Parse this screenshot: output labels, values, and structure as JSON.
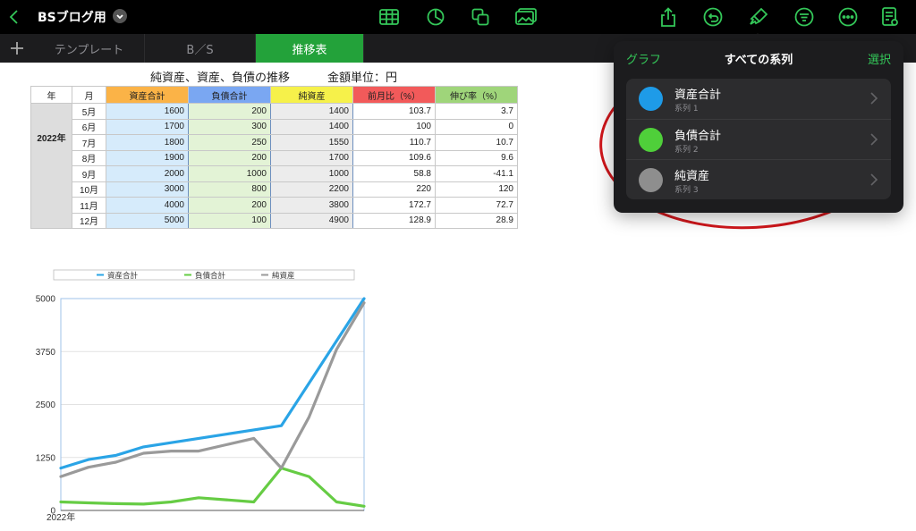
{
  "toolbar": {
    "document_title": "BSブログ用",
    "icons": [
      "back-icon",
      "table-icon",
      "chart-icon",
      "shapes-icon",
      "media-icon",
      "share-icon",
      "undo-icon",
      "format-brush-icon",
      "filter-icon",
      "more-icon",
      "document-icon"
    ]
  },
  "tabs": [
    {
      "label": "テンプレート",
      "active": false
    },
    {
      "label": "B／S",
      "active": false
    },
    {
      "label": "推移表",
      "active": true
    }
  ],
  "table": {
    "title": "純資産、資産、負債の推移",
    "unit": "金額単位：円",
    "headers": [
      {
        "label": "年",
        "color": "#ffffff"
      },
      {
        "label": "月",
        "color": "#ffffff"
      },
      {
        "label": "資産合計",
        "color": "#fbb347"
      },
      {
        "label": "負債合計",
        "color": "#7aa7f2"
      },
      {
        "label": "純資産",
        "color": "#f6f14a"
      },
      {
        "label": "前月比（%）",
        "color": "#f25a5a"
      },
      {
        "label": "伸び率（%）",
        "color": "#9fd57a"
      }
    ],
    "year": "2022年",
    "rows": [
      [
        "5月",
        "1600",
        "200",
        "1400",
        "103.7",
        "3.7"
      ],
      [
        "6月",
        "1700",
        "300",
        "1400",
        "100",
        "0"
      ],
      [
        "7月",
        "1800",
        "250",
        "1550",
        "110.7",
        "10.7"
      ],
      [
        "8月",
        "1900",
        "200",
        "1700",
        "109.6",
        "9.6"
      ],
      [
        "9月",
        "2000",
        "1000",
        "1000",
        "58.8",
        "-41.1"
      ],
      [
        "10月",
        "3000",
        "800",
        "2200",
        "220",
        "120"
      ],
      [
        "11月",
        "4000",
        "200",
        "3800",
        "172.7",
        "72.7"
      ],
      [
        "12月",
        "5000",
        "100",
        "4900",
        "128.9",
        "28.9"
      ]
    ],
    "column_colors": [
      "#ffffff",
      "#d6ebfb",
      "#e3f3d6",
      "#ececec",
      "#ffffff",
      "#ffffff"
    ]
  },
  "chart_data": {
    "type": "line",
    "title": "",
    "xlabel": "",
    "ylabel": "",
    "x_axis_label": "2022年",
    "ylim": [
      0,
      5000
    ],
    "y_ticks": [
      "0",
      "1250",
      "2500",
      "3750",
      "5000"
    ],
    "legend_position": "top",
    "grid": true,
    "series": [
      {
        "name": "資産合計",
        "color": "#2aa4e6",
        "values": [
          1000,
          1200,
          1300,
          1500,
          1600,
          1700,
          1800,
          1900,
          2000,
          3000,
          4000,
          5000
        ]
      },
      {
        "name": "負債合計",
        "color": "#66cc44",
        "values": [
          200,
          180,
          160,
          150,
          200,
          300,
          250,
          200,
          1000,
          800,
          200,
          100
        ]
      },
      {
        "name": "純資産",
        "color": "#9a9a9a",
        "values": [
          800,
          1020,
          1140,
          1350,
          1400,
          1400,
          1550,
          1700,
          1000,
          2200,
          3800,
          4900
        ]
      }
    ]
  },
  "popover": {
    "back_label": "グラフ",
    "title": "すべての系列",
    "select_label": "選択",
    "series": [
      {
        "name": "資産合計",
        "sub": "系列 1",
        "color": "#1e9be8"
      },
      {
        "name": "負債合計",
        "sub": "系列 2",
        "color": "#4fcf3a"
      },
      {
        "name": "純資産",
        "sub": "系列 3",
        "color": "#8e8e8e"
      }
    ]
  }
}
